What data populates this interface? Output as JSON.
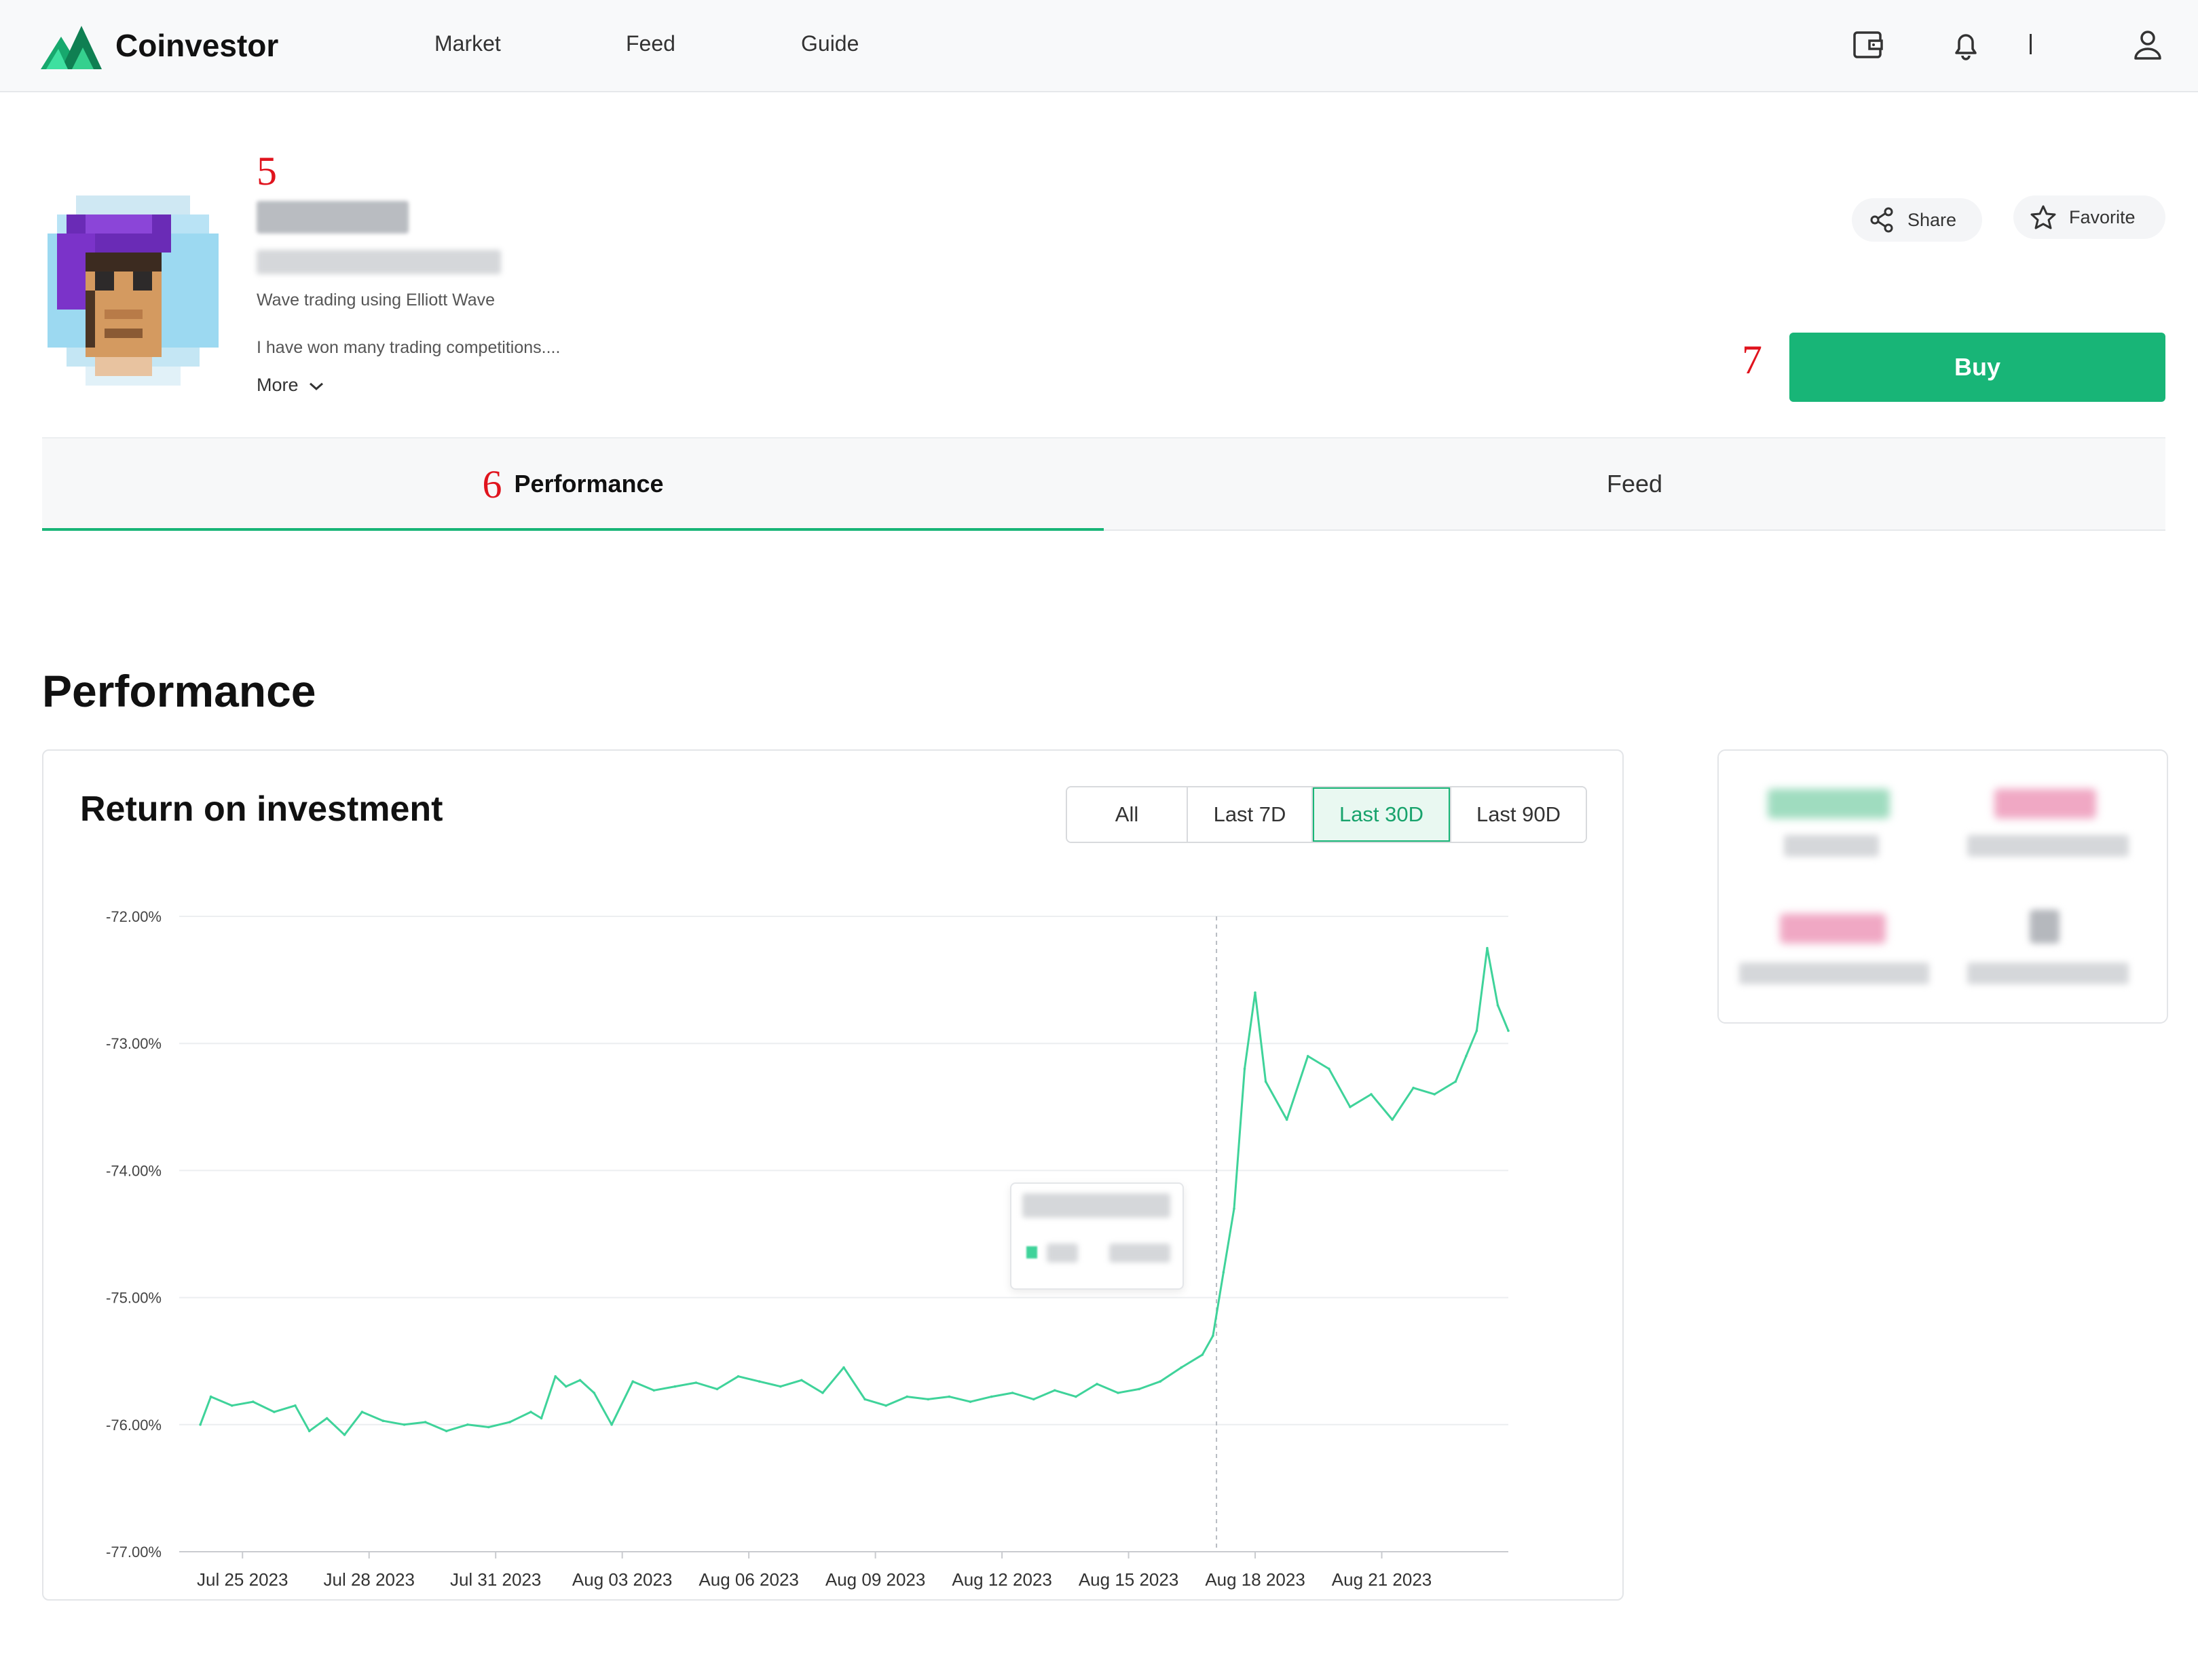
{
  "header": {
    "brand": "Coinvestor",
    "nav": [
      "Market",
      "Feed",
      "Guide"
    ],
    "divider": "|"
  },
  "profile": {
    "tagline": "Wave trading using Elliott Wave",
    "bio": "I have won many trading competitions....",
    "more_label": "More",
    "share_label": "Share",
    "favorite_label": "Favorite",
    "buy_label": "Buy"
  },
  "annotations": {
    "five": "5",
    "six": "6",
    "seven": "7"
  },
  "tabs": [
    {
      "label": "Performance",
      "active": true
    },
    {
      "label": "Feed",
      "active": false
    }
  ],
  "performance": {
    "heading": "Performance",
    "card_title": "Return on investment",
    "ranges": [
      {
        "label": "All",
        "active": false
      },
      {
        "label": "Last 7D",
        "active": false
      },
      {
        "label": "Last 30D",
        "active": true
      },
      {
        "label": "Last 90D",
        "active": false
      }
    ]
  },
  "colors": {
    "accent": "#18b577",
    "line": "#3fd39a",
    "positive_blur": "#9fdcbf",
    "negative_blur": "#f0a8c4"
  },
  "chart_data": {
    "type": "line",
    "title": "Return on investment",
    "xlabel": "",
    "ylabel": "",
    "ylim": [
      -77,
      -72
    ],
    "y_ticks": [
      "-72.00%",
      "-73.00%",
      "-74.00%",
      "-75.00%",
      "-76.00%",
      "-77.00%"
    ],
    "y_tick_values": [
      -72,
      -73,
      -74,
      -75,
      -76,
      -77
    ],
    "x_ticks": [
      "Jul 25 2023",
      "Jul 28 2023",
      "Jul 31 2023",
      "Aug 03 2023",
      "Aug 06 2023",
      "Aug 09 2023",
      "Aug 12 2023",
      "Aug 15 2023",
      "Aug 18 2023",
      "Aug 21 2023"
    ],
    "grid": true,
    "series": [
      {
        "x": [
          "2023-07-24 12:00",
          "2023-07-24 18:00",
          "2023-07-25 06:00",
          "2023-07-25 18:00",
          "2023-07-26 06:00",
          "2023-07-26 18:00",
          "2023-07-27 02:00",
          "2023-07-27 12:00",
          "2023-07-27 22:00",
          "2023-07-28 08:00",
          "2023-07-28 20:00",
          "2023-07-29 08:00",
          "2023-07-29 20:00",
          "2023-07-30 08:00",
          "2023-07-30 20:00",
          "2023-07-31 08:00",
          "2023-07-31 20:00",
          "2023-08-01 08:00",
          "2023-08-01 14:00",
          "2023-08-01 22:00",
          "2023-08-02 04:00",
          "2023-08-02 12:00",
          "2023-08-02 20:00",
          "2023-08-03 06:00",
          "2023-08-03 18:00",
          "2023-08-04 06:00",
          "2023-08-04 18:00",
          "2023-08-05 06:00",
          "2023-08-05 18:00",
          "2023-08-06 06:00",
          "2023-08-06 18:00",
          "2023-08-07 06:00",
          "2023-08-07 18:00",
          "2023-08-08 06:00",
          "2023-08-08 18:00",
          "2023-08-09 06:00",
          "2023-08-09 18:00",
          "2023-08-10 06:00",
          "2023-08-10 18:00",
          "2023-08-11 06:00",
          "2023-08-11 18:00",
          "2023-08-12 06:00",
          "2023-08-12 18:00",
          "2023-08-13 06:00",
          "2023-08-13 18:00",
          "2023-08-14 06:00",
          "2023-08-14 18:00",
          "2023-08-15 06:00",
          "2023-08-15 18:00",
          "2023-08-16 06:00",
          "2023-08-16 18:00",
          "2023-08-17 06:00",
          "2023-08-17 12:00",
          "2023-08-17 18:00",
          "2023-08-18 00:00",
          "2023-08-18 06:00",
          "2023-08-18 12:00",
          "2023-08-18 18:00",
          "2023-08-19 06:00",
          "2023-08-19 18:00",
          "2023-08-20 06:00",
          "2023-08-20 18:00",
          "2023-08-21 06:00",
          "2023-08-21 18:00",
          "2023-08-22 06:00",
          "2023-08-22 18:00",
          "2023-08-23 06:00",
          "2023-08-23 12:00",
          "2023-08-23 18:00",
          "2023-08-24 00:00",
          "2023-08-24 06:00",
          "2023-08-24 12:00"
        ],
        "values": [
          -76.0,
          -75.78,
          -75.85,
          -75.82,
          -75.9,
          -75.85,
          -76.05,
          -75.95,
          -76.08,
          -75.9,
          -75.97,
          -76.0,
          -75.98,
          -76.05,
          -76.0,
          -76.02,
          -75.98,
          -75.9,
          -75.95,
          -75.62,
          -75.7,
          -75.65,
          -75.75,
          -76.0,
          -75.66,
          -75.73,
          -75.7,
          -75.67,
          -75.72,
          -75.62,
          -75.66,
          -75.7,
          -75.65,
          -75.75,
          -75.55,
          -75.8,
          -75.85,
          -75.78,
          -75.8,
          -75.78,
          -75.82,
          -75.78,
          -75.75,
          -75.8,
          -75.73,
          -75.78,
          -75.68,
          -75.75,
          -75.72,
          -75.66,
          -75.55,
          -75.45,
          -75.3,
          -74.8,
          -74.3,
          -73.2,
          -72.6,
          -73.3,
          -73.6,
          -73.1,
          -73.2,
          -73.5,
          -73.4,
          -73.6,
          -73.35,
          -73.4,
          -73.3,
          -73.1,
          -72.9,
          -72.25,
          -72.7,
          -72.9
        ]
      }
    ],
    "cursor_x": "2023-08-17 14:00"
  }
}
